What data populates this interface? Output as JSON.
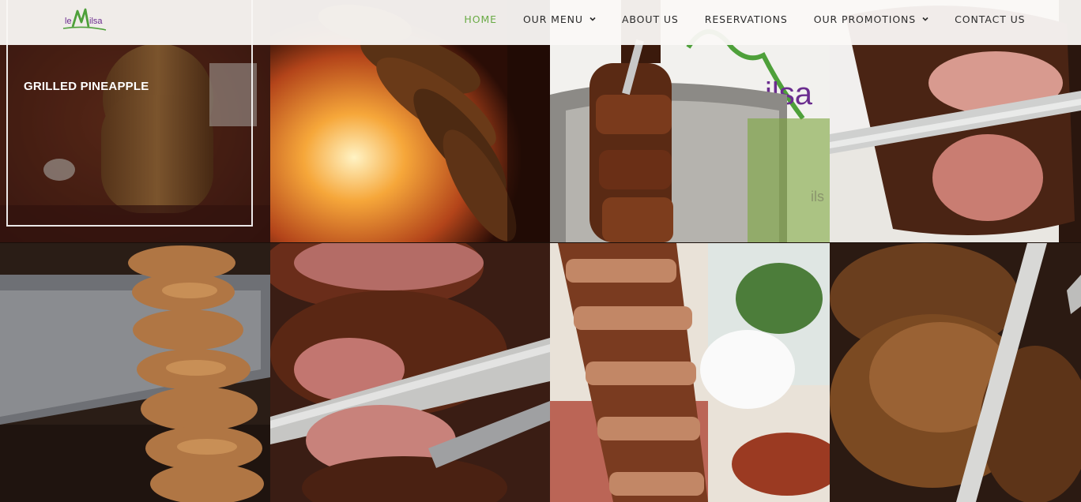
{
  "brand": {
    "logo_text_le": "le",
    "logo_text_name": "ilsa",
    "logo_alt": "le Milsa"
  },
  "nav": {
    "items": [
      {
        "label": "HOME",
        "active": true,
        "dropdown": false
      },
      {
        "label": "OUR MENU",
        "active": false,
        "dropdown": true
      },
      {
        "label": "ABOUT US",
        "active": false,
        "dropdown": false
      },
      {
        "label": "RESERVATIONS",
        "active": false,
        "dropdown": false
      },
      {
        "label": "OUR PROMOTIONS",
        "active": false,
        "dropdown": true
      },
      {
        "label": "CONTACT US",
        "active": false,
        "dropdown": false
      }
    ]
  },
  "gallery": {
    "hover_caption": "GRILLED PINEAPPLE",
    "tiles": [
      {
        "subject": "grilled-pineapple"
      },
      {
        "subject": "sausages-over-fire"
      },
      {
        "subject": "meat-skewer-with-logo-banner"
      },
      {
        "subject": "roast-beef-carving"
      },
      {
        "subject": "chicken-skewer"
      },
      {
        "subject": "picanha-carving"
      },
      {
        "subject": "pork-belly-skewer"
      },
      {
        "subject": "lamb-carving"
      }
    ]
  },
  "colors": {
    "accent": "#6aab45",
    "logo_purple": "#6b2d8f",
    "header_bg": "#faf8f6"
  }
}
